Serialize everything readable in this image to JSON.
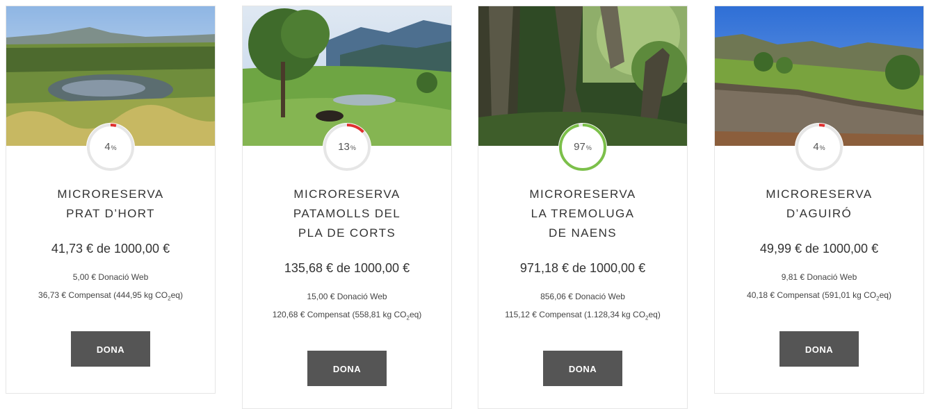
{
  "projects": [
    {
      "title_lines": [
        "MICRORESERVA",
        "PRAT D’HORT"
      ],
      "percent": "4",
      "percent_value": 4,
      "percent_sign": "%",
      "amount": "41,73 € de 1000,00 €",
      "donacio": "5,00 € Donació Web",
      "compensat_prefix": "36,73 € Compensat (444,95 kg CO",
      "co2_sub": "2",
      "compensat_suffix": "eq)",
      "button": "DONA"
    },
    {
      "title_lines": [
        "MICRORESERVA",
        "PATAMOLLS DEL",
        "PLA DE CORTS"
      ],
      "percent": "13",
      "percent_value": 13,
      "percent_sign": "%",
      "amount": "135,68 € de 1000,00 €",
      "donacio": "15,00 € Donació Web",
      "compensat_prefix": "120,68 € Compensat (558,81 kg CO",
      "co2_sub": "2",
      "compensat_suffix": "eq)",
      "button": "DONA"
    },
    {
      "title_lines": [
        "MICRORESERVA",
        "LA TREMOLUGA",
        "DE NAENS"
      ],
      "percent": "97",
      "percent_value": 97,
      "percent_sign": "%",
      "amount": "971,18 € de 1000,00 €",
      "donacio": "856,06 € Donació Web",
      "compensat_prefix": "115,12 € Compensat (1.128,34 kg CO",
      "co2_sub": "2",
      "compensat_suffix": "eq)",
      "button": "DONA"
    },
    {
      "title_lines": [
        "MICRORESERVA",
        "D’AGUIRÓ"
      ],
      "percent": "4",
      "percent_value": 4,
      "percent_sign": "%",
      "amount": "49,99 € de 1000,00 €",
      "donacio": "9,81 € Donació Web",
      "compensat_prefix": "40,18 € Compensat (591,01 kg CO",
      "co2_sub": "2",
      "compensat_suffix": "eq)",
      "button": "DONA"
    }
  ],
  "colors": {
    "low_progress": "#e03030",
    "high_progress": "#7cc04a",
    "ring_track": "#e6e6e6",
    "button_bg": "#555555"
  }
}
